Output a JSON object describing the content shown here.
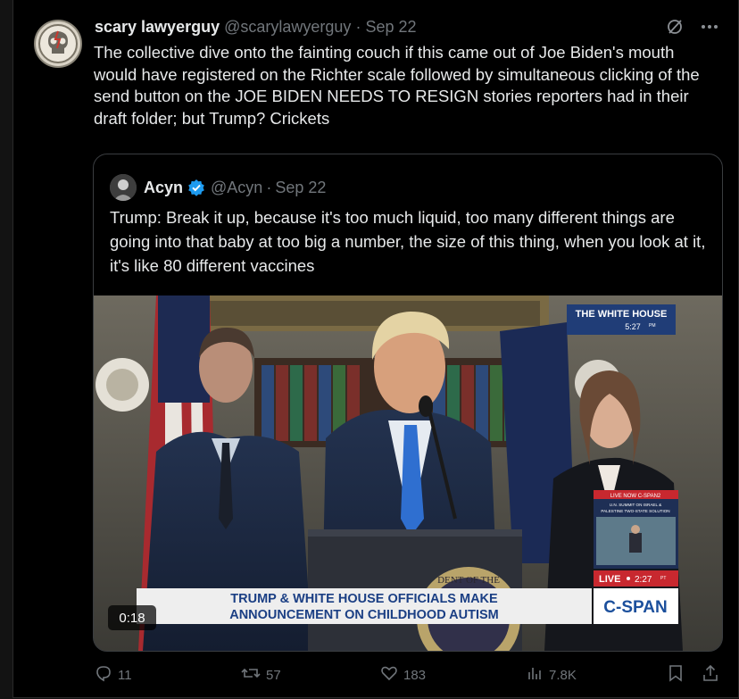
{
  "tweet": {
    "author_name": "scary lawyerguy",
    "handle": "@scarylawyerguy",
    "separator": "·",
    "date": "Sep 22",
    "text": "The collective dive onto the fainting couch if this came out of Joe Biden's mouth would have registered on the Richter scale followed by simultaneous clicking of the send button on the JOE BIDEN NEEDS TO RESIGN stories reporters had in their draft folder; but Trump? Crickets",
    "more_icon": "more-icon",
    "grok_icon": "slash-circle-icon"
  },
  "quote": {
    "author_name": "Acyn",
    "verified": true,
    "verified_color": "#1d9bf0",
    "handle": "@Acyn",
    "separator": "·",
    "date": "Sep 22",
    "text": "Trump: Break it up, because it's too much liquid, too many different things are going into that baby at too big a number, the size of this thing, when you look at it, it's like 80 different vaccines"
  },
  "video": {
    "duration": "0:18",
    "bug_title": "THE WHITE HOUSE",
    "bug_time": "5:27",
    "bug_time_suffix": "PM",
    "chyron_line1": "TRUMP & WHITE HOUSE OFFICIALS MAKE",
    "chyron_line2": "ANNOUNCEMENT ON CHILDHOOD AUTISM",
    "network": "C-SPAN",
    "live_label": "LIVE",
    "live_time": "2:27",
    "live_time_suffix": "PT",
    "inset_header": "LIVE NOW C-SPAN2",
    "inset_sub1": "U.N. SUMMIT ON ISRAEL &",
    "inset_sub2": "PALESTINE TWO-STATE SOLUTION",
    "podium_seal_text": "DENT OF THE"
  },
  "actions": {
    "replies": "11",
    "reposts": "57",
    "likes": "183",
    "views": "7.8K"
  },
  "colors": {
    "background": "#000000",
    "text": "#e7e9ea",
    "muted": "#71767b",
    "accent": "#1d9bf0",
    "cspan_blue": "#1b4f9c",
    "live_red": "#d02027"
  }
}
